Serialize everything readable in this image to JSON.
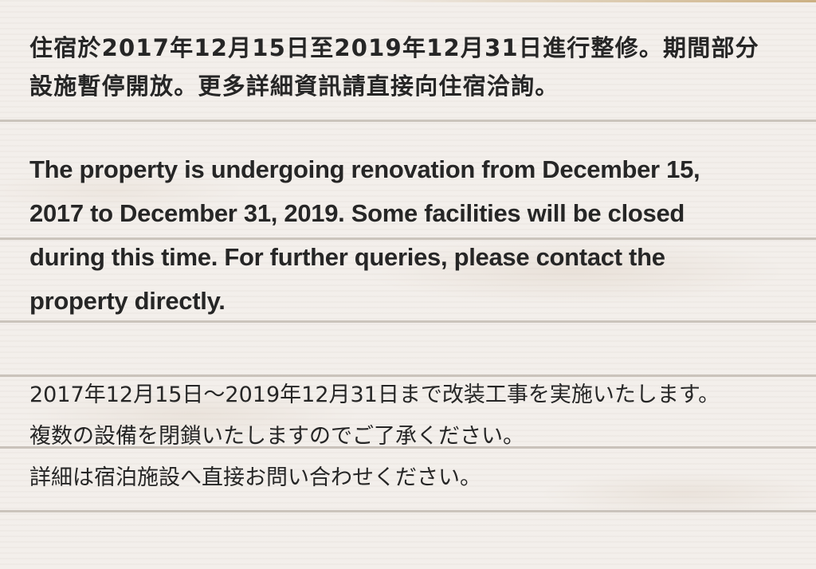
{
  "notice": {
    "chinese": {
      "lines": [
        "住宿於2017年12月15日至2019年12月31日進行整修。期間部分",
        "設施暫停開放。更多詳細資訊請直接向住宿洽詢。"
      ]
    },
    "english": {
      "lines": [
        "The property is undergoing renovation from December 15,",
        "2017 to December 31, 2019. Some facilities will be closed",
        "during this time. For further queries, please contact the",
        "property directly."
      ]
    },
    "japanese": {
      "lines": [
        "2017年12月15日〜2019年12月31日まで改装工事を実施いたします。",
        "複数の設備を閉鎖いたしますのでご了承ください。",
        "詳細は宿泊施設へ直接お問い合わせください。"
      ]
    }
  },
  "colors": {
    "text": "#262626",
    "background": "#f3efeb",
    "plank_seam": "#aaa096"
  }
}
